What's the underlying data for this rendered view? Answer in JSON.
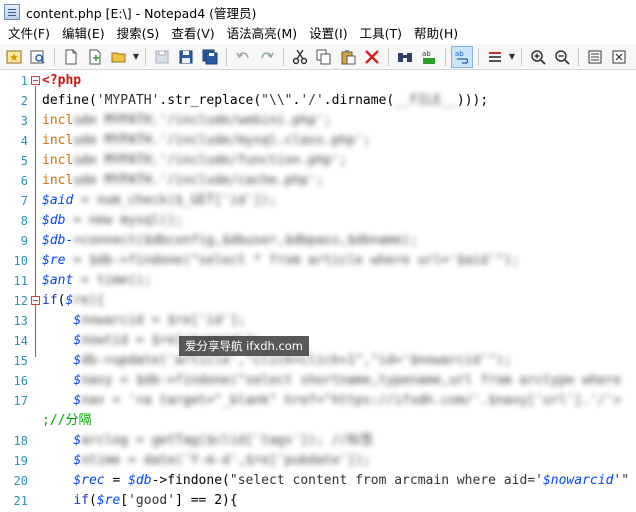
{
  "window": {
    "title": "content.php [E:\\] - Notepad4 (管理员)"
  },
  "menu": [
    "文件(F)",
    "编辑(E)",
    "搜索(S)",
    "查看(V)",
    "语法高亮(M)",
    "设置(I)",
    "工具(T)",
    "帮助(H)"
  ],
  "toolbar": {
    "icons": [
      "favorites-icon",
      "find-in-files-icon",
      "new-file-icon",
      "new-window-icon",
      "open-folder-icon",
      "save-disabled-icon",
      "save-icon",
      "save-all-icon",
      "undo-icon",
      "redo-icon",
      "cut-icon",
      "copy-icon",
      "paste-icon",
      "delete-icon",
      "find-icon",
      "replace-icon",
      "word-wrap-icon",
      "scheme-icon",
      "zoom-in-icon",
      "zoom-out-icon",
      "settings-icon",
      "close-icon"
    ]
  },
  "editor": {
    "lines": [
      {
        "num": "1",
        "parts": [
          [
            "php",
            "<?php"
          ]
        ]
      },
      {
        "num": "2",
        "parts": [
          [
            "plain",
            "define("
          ],
          [
            "str",
            "'MYPATH'"
          ],
          [
            "plain",
            ".str_replace("
          ],
          [
            "str",
            "\"\\\\\""
          ],
          [
            "plain",
            "."
          ],
          [
            "str",
            "'/'"
          ],
          [
            "plain",
            ".dirname("
          ],
          [
            "blur",
            "__FILE__"
          ],
          [
            "plain",
            ")));"
          ]
        ]
      },
      {
        "num": "3",
        "parts": [
          [
            "incl",
            "incl"
          ],
          [
            "blur",
            "ude MYPATH.'/include/webini.php';"
          ]
        ]
      },
      {
        "num": "4",
        "parts": [
          [
            "incl",
            "incl"
          ],
          [
            "blur",
            "ude MYPATH.'/include/mysql.class.php';"
          ]
        ]
      },
      {
        "num": "5",
        "parts": [
          [
            "incl",
            "incl"
          ],
          [
            "blur",
            "ude MYPATH.'/include/function.php';"
          ]
        ]
      },
      {
        "num": "6",
        "parts": [
          [
            "incl",
            "incl"
          ],
          [
            "blur",
            "ude MYPATH.'/include/cache.php';"
          ]
        ]
      },
      {
        "num": "7",
        "parts": [
          [
            "var",
            "$aid"
          ],
          [
            "blur",
            " = num_check($_GET['id']);"
          ]
        ]
      },
      {
        "num": "8",
        "parts": [
          [
            "var",
            "$db"
          ],
          [
            "blur",
            " = new mysql();"
          ]
        ]
      },
      {
        "num": "9",
        "parts": [
          [
            "var",
            "$db-"
          ],
          [
            "blur",
            ">connect($dbconfig,$dbuser,$dbpass,$dbname);"
          ]
        ]
      },
      {
        "num": "10",
        "parts": [
          [
            "var",
            "$re"
          ],
          [
            "blur",
            " = $db->findone(\"select * from article where url='$aid'\");"
          ]
        ]
      },
      {
        "num": "11",
        "parts": [
          [
            "var",
            "$ant"
          ],
          [
            "blur",
            " = time();"
          ]
        ]
      },
      {
        "num": "12",
        "parts": [
          [
            "kw",
            "if"
          ],
          [
            "plain",
            "("
          ],
          [
            "var",
            "$"
          ],
          [
            "blur",
            "re){"
          ]
        ]
      },
      {
        "num": "13",
        "parts": [
          [
            "plain",
            "    "
          ],
          [
            "var",
            "$"
          ],
          [
            "blur",
            "nowarcid = $re['id'];"
          ]
        ]
      },
      {
        "num": "14",
        "parts": [
          [
            "plain",
            "    "
          ],
          [
            "var",
            "$"
          ],
          [
            "blur",
            "nowtid = $re['typeid'];"
          ]
        ]
      },
      {
        "num": "15",
        "parts": [
          [
            "plain",
            "    "
          ],
          [
            "var",
            "$"
          ],
          [
            "blur",
            "db->update('article',\"click=click+1\",\"id='$nowarcid'\");"
          ]
        ]
      },
      {
        "num": "16",
        "parts": [
          [
            "plain",
            "    "
          ],
          [
            "var",
            "$"
          ],
          [
            "blur",
            "navy = $db->findone(\"select shortname,typename,url from arctype where"
          ]
        ]
      },
      {
        "num": "17",
        "parts": [
          [
            "plain",
            "    "
          ],
          [
            "var",
            "$"
          ],
          [
            "blur",
            "nav = '<a target=\"_blank\" href=\"https://ifxdh.com/'.$navy['url'].'/'>"
          ]
        ]
      },
      {
        "num": "",
        "parts": [
          [
            "cmt",
            ";//分隔"
          ]
        ]
      },
      {
        "num": "18",
        "parts": [
          [
            "plain",
            "    "
          ],
          [
            "var",
            "$"
          ],
          [
            "blur",
            "arclog = getTag($clid['tags']); //标签"
          ]
        ]
      },
      {
        "num": "19",
        "parts": [
          [
            "plain",
            "    "
          ],
          [
            "var",
            "$"
          ],
          [
            "blur",
            "ntime = date('Y-m-d',$re['pubdate']);"
          ]
        ]
      },
      {
        "num": "20",
        "parts": [
          [
            "plain",
            "    "
          ],
          [
            "var",
            "$rec"
          ],
          [
            "plain",
            " = "
          ],
          [
            "var",
            "$db"
          ],
          [
            "plain",
            "->findone("
          ],
          [
            "str",
            "\"select content from arcmain where aid='"
          ],
          [
            "var",
            "$nowarcid"
          ],
          [
            "str",
            "'\""
          ]
        ]
      },
      {
        "num": "21",
        "parts": [
          [
            "plain",
            "    "
          ],
          [
            "kw",
            "if"
          ],
          [
            "plain",
            "("
          ],
          [
            "var",
            "$re"
          ],
          [
            "plain",
            "["
          ],
          [
            "str",
            "'good'"
          ],
          [
            "plain",
            "] == 2){"
          ]
        ]
      }
    ]
  },
  "watermark": {
    "text": "爱分享导航 ifxdh.com"
  }
}
